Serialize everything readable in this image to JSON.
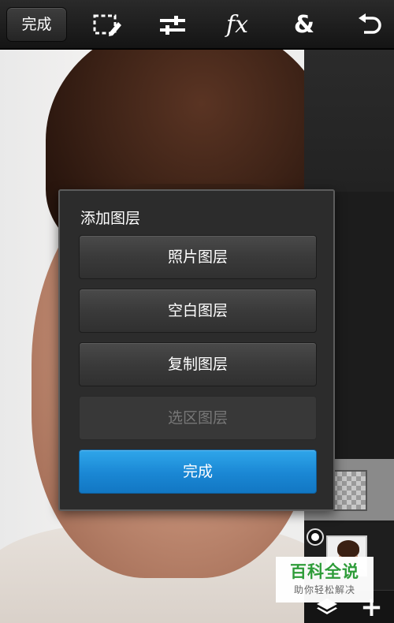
{
  "toolbar": {
    "done_label": "完成",
    "tools": [
      {
        "name": "selection-tool",
        "icon": "selection-pencil-icon"
      },
      {
        "name": "adjust-tool",
        "icon": "sliders-icon"
      },
      {
        "name": "effects-tool",
        "icon": "fx-icon",
        "glyph": "fx"
      },
      {
        "name": "blend-tool",
        "icon": "ampersand-icon",
        "glyph": "&"
      },
      {
        "name": "undo-tool",
        "icon": "undo-icon"
      }
    ]
  },
  "dialog": {
    "title": "添加图层",
    "buttons": [
      {
        "label": "照片图层",
        "enabled": true
      },
      {
        "label": "空白图层",
        "enabled": true
      },
      {
        "label": "复制图层",
        "enabled": true
      },
      {
        "label": "选区图层",
        "enabled": false
      }
    ],
    "done_label": "完成"
  },
  "layers_panel": {
    "bottom_buttons": [
      {
        "icon": "layers-stack-icon"
      },
      {
        "icon": "plus-icon",
        "glyph": "+"
      }
    ]
  },
  "watermark": {
    "main": "百科全说",
    "sub": "助你轻松解决"
  },
  "colors": {
    "primary_button": "#1a87d4",
    "watermark_green": "#2e9c39",
    "toolbar_bg": "#1e1e1e"
  }
}
